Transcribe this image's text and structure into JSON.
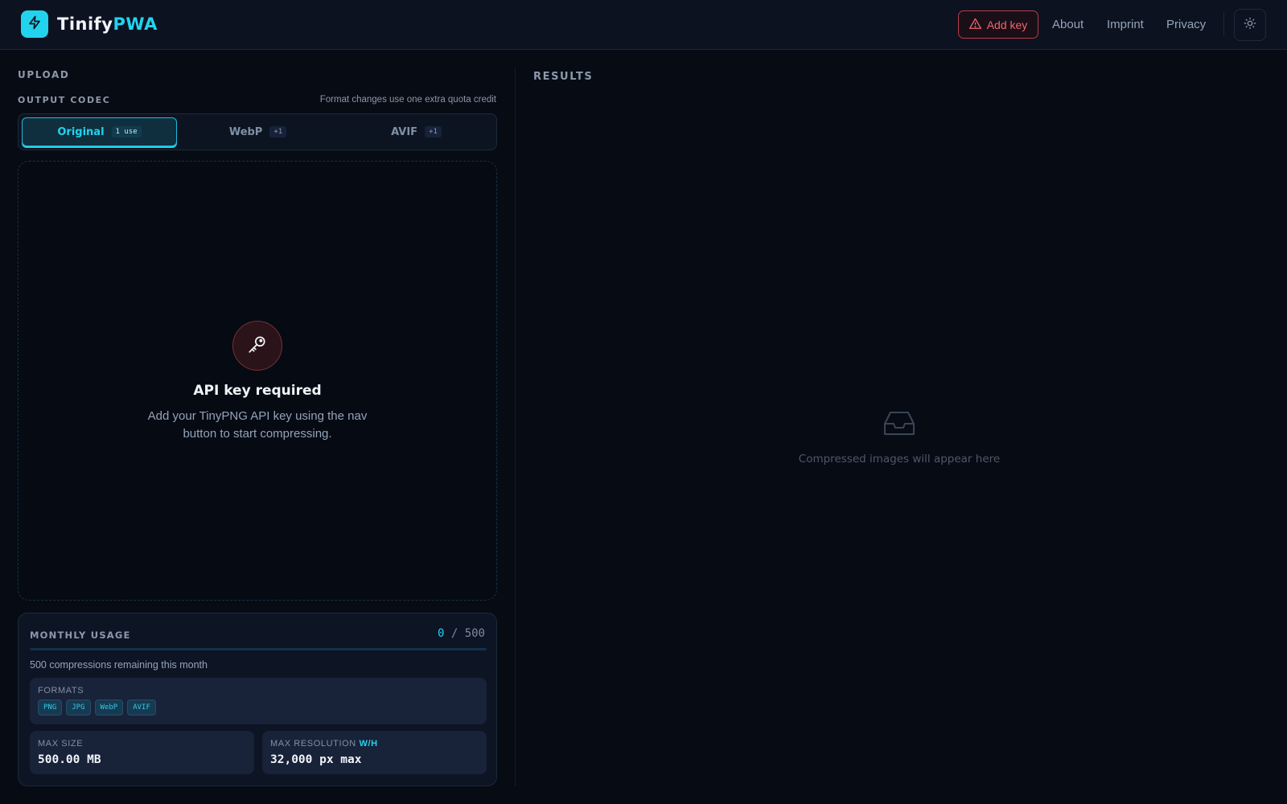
{
  "header": {
    "brand_part1": "Tinify",
    "brand_part2": "PWA",
    "add_key_label": "Add key",
    "nav": [
      "About",
      "Imprint",
      "Privacy"
    ],
    "logo_icon": "lightning-bolt-icon",
    "theme_icon": "sun-icon"
  },
  "upload": {
    "section_label": "UPLOAD",
    "codec_label": "OUTPUT CODEC",
    "codec_note": "Format changes use one extra quota credit",
    "codecs": [
      {
        "label": "Original",
        "badge": "1 use",
        "active": true
      },
      {
        "label": "WebP",
        "badge": "+1",
        "active": false
      },
      {
        "label": "AVIF",
        "badge": "+1",
        "active": false
      }
    ],
    "api_title": "API key required",
    "api_description": "Add your TinyPNG API key using the nav button to start compressing.",
    "key_icon": "key-icon"
  },
  "usage": {
    "label": "MONTHLY USAGE",
    "used": "0",
    "separator": "/",
    "limit": "500",
    "progress_fraction": 0,
    "remaining_text": "500 compressions remaining this month",
    "formats_label": "FORMATS",
    "formats": [
      "PNG",
      "JPG",
      "WebP",
      "AVIF"
    ],
    "max_size_label": "MAX SIZE",
    "max_size_value": "500.00 MB",
    "max_res_label": "MAX RESOLUTION",
    "max_res_accent": "W/H",
    "max_res_value": "32,000 px max"
  },
  "results": {
    "section_label": "RESULTS",
    "empty_text": "Compressed images will appear here",
    "empty_icon": "inbox-icon"
  },
  "colors": {
    "accent": "#22d3ee",
    "danger": "#f26371",
    "background": "#070b14"
  }
}
